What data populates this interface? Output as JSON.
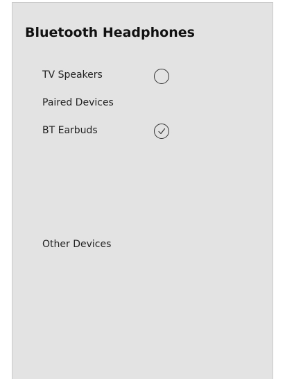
{
  "panel": {
    "title": "Bluetooth Headphones"
  },
  "devices": {
    "tv_speakers": {
      "label": "TV Speakers",
      "selected": false
    },
    "paired_header": "Paired Devices",
    "bt_earbuds": {
      "label": "BT Earbuds",
      "selected": true
    },
    "other_header": "Other Devices"
  },
  "icons": {
    "unselected": "radio-empty-icon",
    "selected": "radio-check-icon"
  }
}
